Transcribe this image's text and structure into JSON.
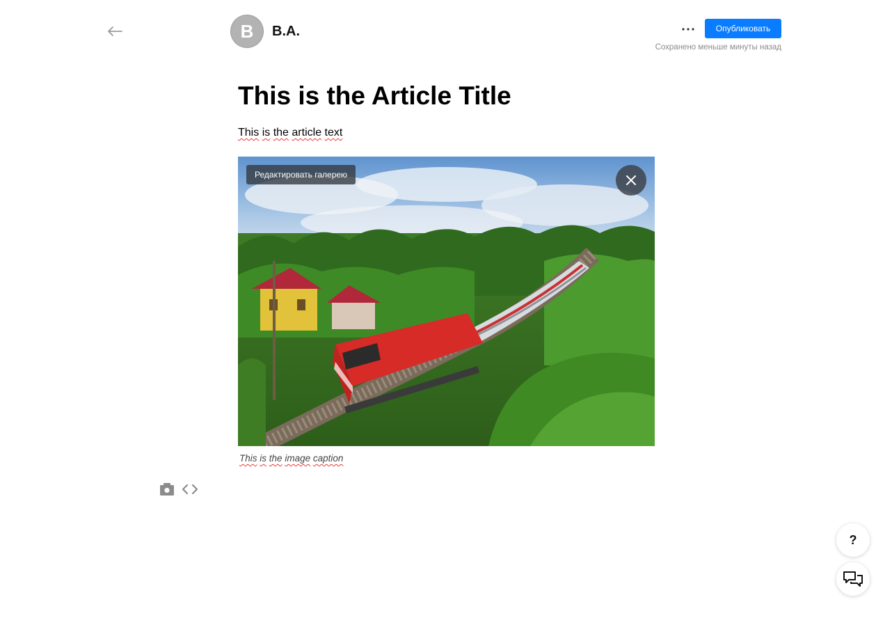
{
  "header": {
    "author_initial": "B",
    "author_name": "B.A.",
    "publish_label": "Опубликовать",
    "saved_status": "Сохранено меньше минуты назад"
  },
  "article": {
    "title": "This is the Article Title",
    "text_words": [
      "This",
      "is",
      "the",
      "article",
      "text"
    ],
    "gallery": {
      "edit_label": "Редактировать галерею"
    },
    "caption_words": [
      "This",
      "is",
      "the",
      "image",
      "caption"
    ]
  },
  "help": {
    "help_label": "?"
  },
  "colors": {
    "accent": "#0a7cff",
    "avatar": "#b3b3b3",
    "spellcheck": "#e53935"
  },
  "icons": {
    "back": "arrow-left-icon",
    "more": "more-dots-icon",
    "close": "close-icon",
    "camera": "camera-icon",
    "embed": "code-brackets-icon",
    "chat": "chat-bubbles-icon"
  }
}
